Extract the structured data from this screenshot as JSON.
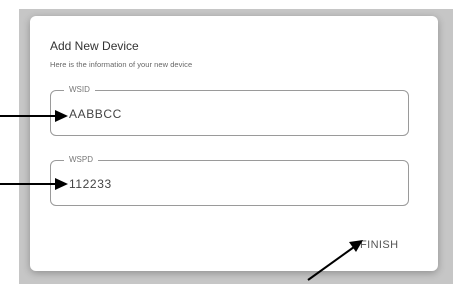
{
  "dialog": {
    "title": "Add New Device",
    "subtitle": "Here is the information of your new device"
  },
  "fields": [
    {
      "label": "WSID",
      "value": "AABBCC"
    },
    {
      "label": "WSPD",
      "value": "112233"
    }
  ],
  "actions": {
    "finish_label": "FINISH"
  },
  "annotations": {
    "arrow_color": "#000000",
    "overlay_color": "#c6c6c6"
  }
}
